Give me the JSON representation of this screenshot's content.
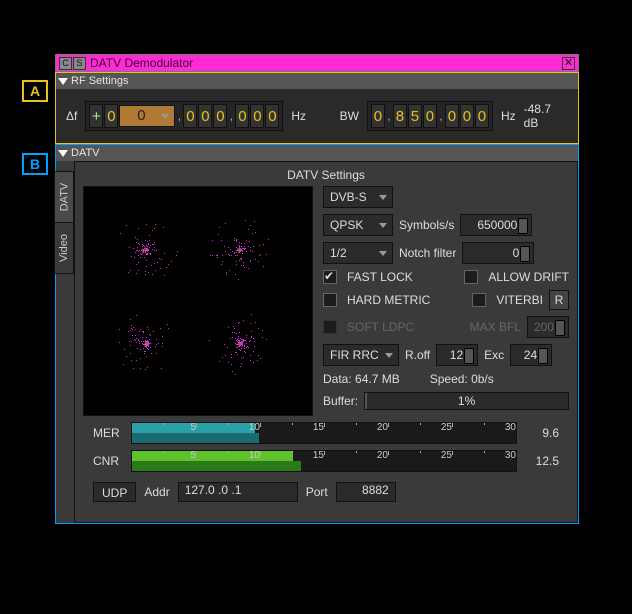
{
  "annotations": {
    "a": "A",
    "b": "B"
  },
  "titlebar": {
    "btn_c": "C",
    "btn_s": "S",
    "title": "DATV Demodulator",
    "close": "✕"
  },
  "rf": {
    "header": "RF Settings",
    "df_label": "Δf",
    "freq_sign": "+",
    "freq_digits": [
      "0",
      "0",
      "0",
      "0",
      "0",
      "0",
      "0",
      "0",
      "0"
    ],
    "freq_unit": "Hz",
    "bw_label": "BW",
    "bw_digits": [
      "0",
      "8",
      "5",
      "0",
      "0",
      "0",
      "0"
    ],
    "bw_unit": "Hz",
    "power": "-48.7 dB"
  },
  "datv": {
    "header": "DATV",
    "tabs": {
      "t1": "DATV",
      "t2": "Video"
    },
    "settings_title": "DATV Settings",
    "dvb": {
      "value": "DVB-S"
    },
    "mod": {
      "value": "QPSK"
    },
    "symbolrate_label": "Symbols/s",
    "symbolrate": "650000",
    "fec": {
      "value": "1/2"
    },
    "notch_label": "Notch filter",
    "notch": "0",
    "chk_fastlock": "FAST LOCK",
    "chk_allowdrift": "ALLOW DRIFT",
    "chk_hardmetric": "HARD METRIC",
    "chk_viterbi": "VITERBI",
    "btn_r": "R",
    "chk_softldpc": "SOFT LDPC",
    "maxbfl_label": "MAX BFL",
    "maxbfl": "200",
    "fir": {
      "value": "FIR RRC"
    },
    "roff_label": "R.off",
    "roff": "12",
    "exc_label": "Exc",
    "exc": "24",
    "data_label": "Data: 64.7 MB",
    "speed_label": "Speed: 0b/s",
    "buffer_label": "Buffer:",
    "buffer_pct": "1%"
  },
  "meters": {
    "mer_label": "MER",
    "mer_val": "9.6",
    "cnr_label": "CNR",
    "cnr_val": "12.5",
    "ticks": [
      "5",
      "10",
      "15",
      "20",
      "25",
      "30"
    ]
  },
  "udp": {
    "btn": "UDP",
    "addr_label": "Addr",
    "addr": "127.0  .0  .1",
    "port_label": "Port",
    "port": "8882"
  }
}
